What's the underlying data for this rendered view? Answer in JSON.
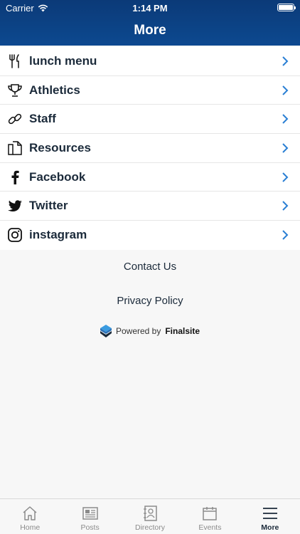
{
  "status_bar": {
    "carrier": "Carrier",
    "time": "1:14 PM"
  },
  "header": {
    "title": "More"
  },
  "menu": {
    "items": [
      {
        "label": "lunch menu",
        "icon": "utensils-icon"
      },
      {
        "label": "Athletics",
        "icon": "trophy-icon"
      },
      {
        "label": "Staff",
        "icon": "link-icon"
      },
      {
        "label": "Resources",
        "icon": "documents-icon"
      },
      {
        "label": "Facebook",
        "icon": "facebook-icon"
      },
      {
        "label": "Twitter",
        "icon": "twitter-icon"
      },
      {
        "label": "instagram",
        "icon": "instagram-icon"
      }
    ]
  },
  "footer": {
    "contact_label": "Contact Us",
    "privacy_label": "Privacy Policy",
    "powered_by_prefix": "Powered by",
    "powered_by_brand": "Finalsite"
  },
  "tabbar": {
    "tabs": [
      {
        "label": "Home",
        "icon": "home-icon"
      },
      {
        "label": "Posts",
        "icon": "newspaper-icon"
      },
      {
        "label": "Directory",
        "icon": "contacts-icon"
      },
      {
        "label": "Events",
        "icon": "calendar-icon"
      },
      {
        "label": "More",
        "icon": "hamburger-menu-icon",
        "active": true
      }
    ]
  },
  "colors": {
    "header_top": "#0b3a78",
    "header_bottom": "#0d4990",
    "chevron": "#2a7fd4",
    "text_dark": "#1b2a3a",
    "tab_inactive": "#8b8b8b"
  }
}
